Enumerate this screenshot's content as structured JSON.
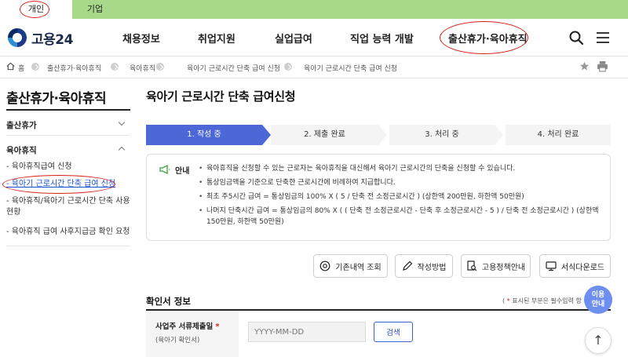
{
  "user_type_tabs": [
    {
      "label": "개인",
      "selected": true
    },
    {
      "label": "기업",
      "selected": false
    }
  ],
  "header": {
    "logo_text": "고용24",
    "nav": [
      "채용정보",
      "취업지원",
      "실업급여",
      "직업 능력 개발",
      "출산휴가·육아휴직"
    ],
    "search_icon": "search-icon",
    "menu_icon": "hamburger-menu-icon"
  },
  "breadcrumb": {
    "items": [
      "홈",
      "출산휴가·육아휴직",
      "육아휴직",
      "육아기 근로시간 단축 급여 신청",
      "육아기 근로시간 단축 급여 신청"
    ]
  },
  "sidebar": {
    "title": "출산휴가·육아휴직",
    "categories": [
      {
        "label": "출산휴가"
      },
      {
        "label": "육아휴직"
      }
    ],
    "links": [
      "- 육아휴직급여 신청",
      "- 육아기 근로시간 단축 급여 신청",
      "- 육아휴직/육아기 근로시간 단축 사용 현황",
      "- 육아휴직 급여 사후지급금 확인 요청"
    ]
  },
  "main": {
    "title": "육아기 근로시간 단축 급여신청",
    "steps": [
      "1. 작성 중",
      "2. 제출 완료",
      "3. 처리 중",
      "4. 처리 완료"
    ],
    "notice": {
      "label": "안내",
      "lines": [
        "육아휴직을 신청할 수 있는 근로자는 육아휴직을 대신해서 육아기 근로시간의 단축을 신청할 수 있습니다.",
        "통상임금액을 기준으로 단축한 근로시간에 비례하여 지급합니다.",
        "최초 주5시간 급여 = 통상임금의 100% X ( 5 / 단축 전 소정근로시간 ) (상한액 200만원, 하한액 50만원)",
        "나머지 단축시간 급여 = 통상임금의 80% X ( ( 단축 전 소정근로시간 - 단축 후 소정근로시간 - 5 ) / 단축 전 소정근로시간 ) (상한액 150만원, 하한액 50만원)"
      ]
    },
    "tool_buttons": [
      "기존내역 조회",
      "작성방법",
      "고용정책안내",
      "서식다운로드"
    ],
    "section_title": "확인서 정보",
    "required_note": "표시된 부분은 필수입력 항",
    "form": {
      "label": "사업주 서류제출일",
      "sublabel": "(육아기 확인서)",
      "date_placeholder": "YYYY-MM-DD",
      "search_button": "검색"
    }
  },
  "floating": {
    "help_line1": "이용",
    "help_line2": "안내",
    "top_arrow": "↑"
  },
  "colors": {
    "accent": "#4d67d6",
    "typebar": "#a8d98a",
    "annotation": "#d8201a",
    "link_active": "#1c4fd1"
  }
}
